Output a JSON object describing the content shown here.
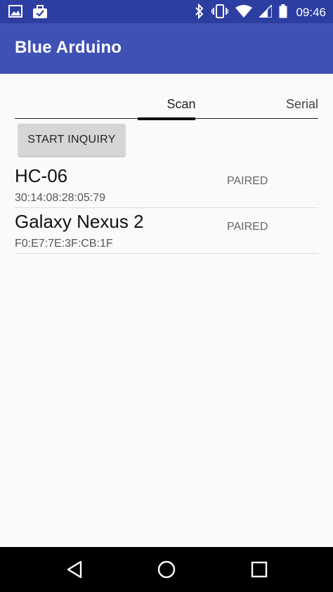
{
  "status_bar": {
    "time": "09:46",
    "icons": [
      "image-icon",
      "briefcase-check-icon",
      "bluetooth-icon",
      "vibrate-icon",
      "wifi-icon",
      "signal-icon",
      "battery-icon"
    ]
  },
  "app_bar": {
    "title": "Blue Arduino",
    "color": "#3f51b5",
    "status_color": "#2c3ea1"
  },
  "tabs": [
    {
      "label": "Scan",
      "selected": true
    },
    {
      "label": "Serial",
      "selected": false
    }
  ],
  "actions": {
    "start_inquiry_label": "START INQUIRY"
  },
  "devices": [
    {
      "name": "HC-06",
      "address": "30:14:08:28:05:79",
      "status": "PAIRED"
    },
    {
      "name": "Galaxy Nexus 2",
      "address": "F0:E7:7E:3F:CB:1F",
      "status": "PAIRED"
    }
  ],
  "nav_bar": {
    "icons": [
      "back-icon",
      "home-icon",
      "recents-icon"
    ]
  }
}
